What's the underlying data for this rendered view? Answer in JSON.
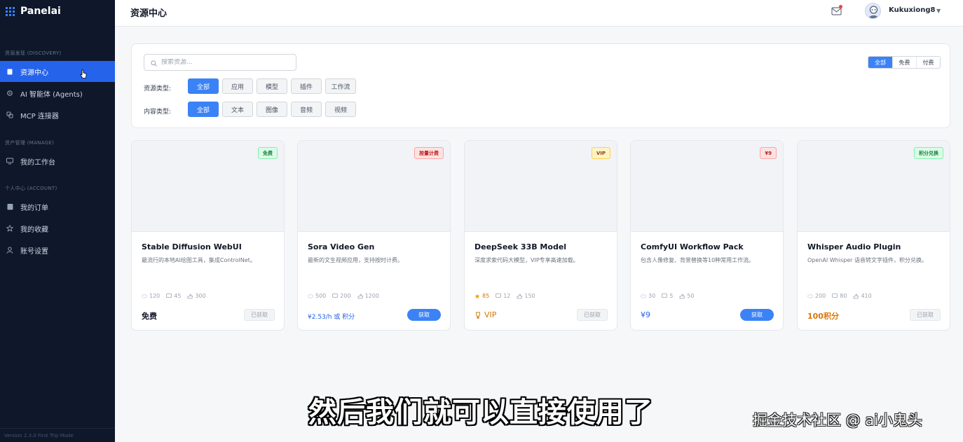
{
  "app": {
    "name": "Panelai",
    "accent": "#2563eb"
  },
  "sidebar": {
    "sections": [
      {
        "title": "资源发现 (DISCOVERY)"
      },
      {
        "title": "资产管理 (MANAGE)"
      },
      {
        "title": "个人中心 (ACCOUNT)"
      }
    ],
    "items": [
      {
        "label": "资源中心",
        "icon": "file-icon",
        "active": true
      },
      {
        "label": "AI 智能体 (Agents)",
        "icon": "gear-icon"
      },
      {
        "label": "MCP 连接器",
        "icon": "link-icon"
      },
      {
        "label": "我的工作台",
        "icon": "monitor-icon"
      },
      {
        "label": "我的订单",
        "icon": "clipboard-icon"
      },
      {
        "label": "我的收藏",
        "icon": "star-icon"
      },
      {
        "label": "账号设置",
        "icon": "user-icon"
      }
    ],
    "footer": "Version 2.3.0 First Trip Mode"
  },
  "header": {
    "title": "资源中心",
    "username": "Kukuxiong8"
  },
  "filters": {
    "search_placeholder": "搜索资源...",
    "price_tabs": [
      "全部",
      "免费",
      "付费"
    ],
    "resource_type_label": "资源类型:",
    "resource_types": [
      "全部",
      "应用",
      "模型",
      "插件",
      "工作流"
    ],
    "content_type_label": "内容类型:",
    "content_types": [
      "全部",
      "文本",
      "图像",
      "音频",
      "视频"
    ]
  },
  "cards": [
    {
      "badge": "免费",
      "name": "Stable Diffusion WebUI",
      "desc": "最流行的本地AI绘图工具，集成ControlNet。",
      "stats": [
        "120",
        "45",
        "300"
      ],
      "price": "免费",
      "action": "已获取"
    },
    {
      "badge": "按量计费",
      "name": "Sora Video Gen",
      "desc": "最新的文生视频应用，支持按时计费。",
      "stats": [
        "500",
        "200",
        "1200"
      ],
      "price": "¥2.53/h 或 积分",
      "action": "获取"
    },
    {
      "badge": "VIP",
      "name": "DeepSeek 33B Model",
      "desc": "深度求索代码大模型，VIP专享高速加载。",
      "stats": [
        "85",
        "12",
        "150"
      ],
      "price": "VIP",
      "action": "已获取"
    },
    {
      "badge": "¥9",
      "name": "ComfyUI Workflow Pack",
      "desc": "包含人像修复、背景替换等10种常用工作流。",
      "stats": [
        "30",
        "5",
        "50"
      ],
      "price": "¥9",
      "action": "获取"
    },
    {
      "badge": "积分兑换",
      "name": "Whisper Audio Plugin",
      "desc": "OpenAI Whisper 语音转文字插件，积分兑换。",
      "stats": [
        "200",
        "80",
        "410"
      ],
      "price": "100积分",
      "action": "已获取"
    }
  ],
  "overlay": {
    "subtitle": "然后我们就可以直接使用了",
    "watermark": "掘金技术社区 @ ai小鬼头"
  }
}
